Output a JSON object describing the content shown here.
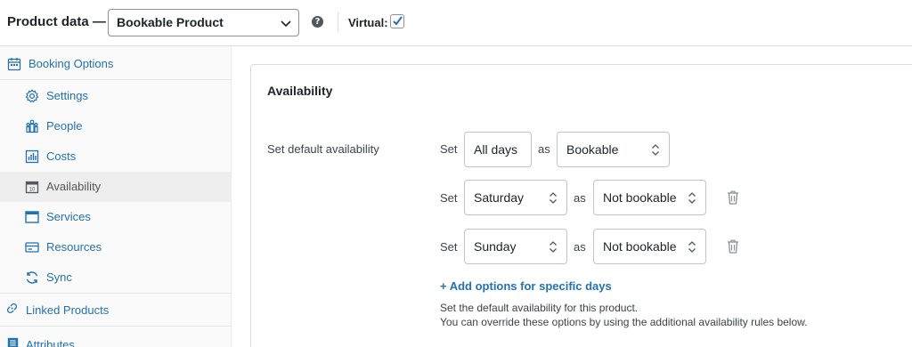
{
  "header": {
    "title": "Product data —",
    "product_type": "Bookable Product",
    "virtual_label": "Virtual:",
    "virtual_checked": true,
    "help_glyph": "?"
  },
  "sidebar": {
    "items": [
      {
        "label": "Booking Options",
        "icon": "calendar-icon"
      },
      {
        "label": "Settings",
        "icon": "gear-icon"
      },
      {
        "label": "People",
        "icon": "people-icon"
      },
      {
        "label": "Costs",
        "icon": "chart-icon"
      },
      {
        "label": "Availability",
        "icon": "calendar-day-icon",
        "active": true
      },
      {
        "label": "Services",
        "icon": "window-icon"
      },
      {
        "label": "Resources",
        "icon": "card-icon"
      },
      {
        "label": "Sync",
        "icon": "sync-icon"
      },
      {
        "label": "Linked Products",
        "icon": "link-icon"
      },
      {
        "label": "Attributes",
        "icon": "list-icon"
      }
    ]
  },
  "availability": {
    "title": "Availability",
    "field_label": "Set default availability",
    "set_word": "Set",
    "as_word": "as",
    "rows": [
      {
        "day": "All days",
        "status": "Bookable",
        "removable": false
      },
      {
        "day": "Saturday",
        "status": "Not bookable",
        "removable": true
      },
      {
        "day": "Sunday",
        "status": "Not bookable",
        "removable": true
      }
    ],
    "add_link": "+ Add options for specific days",
    "help_line1": "Set the default availability for this product.",
    "help_line2": "You can override these options by using the additional availability rules below."
  },
  "colors": {
    "accent": "#2271b1",
    "text": "#1d2327",
    "sidebar_bg": "#fafafa",
    "active_bg": "#eeeeee"
  }
}
